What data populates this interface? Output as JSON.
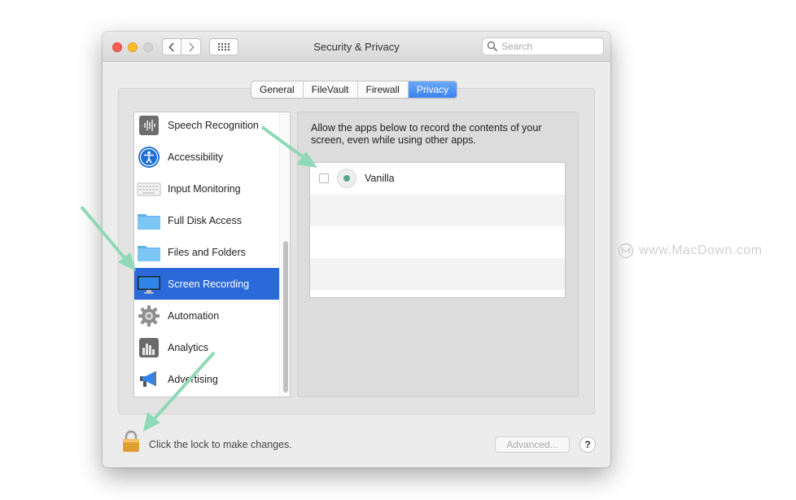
{
  "window": {
    "title": "Security & Privacy",
    "search_placeholder": "Search"
  },
  "tabs": [
    {
      "label": "General",
      "active": false
    },
    {
      "label": "FileVault",
      "active": false
    },
    {
      "label": "Firewall",
      "active": false
    },
    {
      "label": "Privacy",
      "active": true
    }
  ],
  "sidebar": {
    "items": [
      {
        "label": "Speech Recognition",
        "icon": "waveform-icon"
      },
      {
        "label": "Accessibility",
        "icon": "accessibility-icon"
      },
      {
        "label": "Input Monitoring",
        "icon": "keyboard-icon"
      },
      {
        "label": "Full Disk Access",
        "icon": "folder-icon"
      },
      {
        "label": "Files and Folders",
        "icon": "folder-icon"
      },
      {
        "label": "Screen Recording",
        "icon": "display-icon",
        "selected": true
      },
      {
        "label": "Automation",
        "icon": "gear-icon"
      },
      {
        "label": "Analytics",
        "icon": "bar-chart-icon"
      },
      {
        "label": "Advertising",
        "icon": "megaphone-icon"
      }
    ]
  },
  "detail": {
    "description": "Allow the apps below to record the contents of your screen, even while using other apps.",
    "apps": [
      {
        "name": "Vanilla",
        "checked": false
      }
    ]
  },
  "footer": {
    "lock_text": "Click the lock to make changes.",
    "advanced_label": "Advanced...",
    "help_label": "?"
  },
  "watermark": {
    "text": "www.MacDown.com"
  },
  "colors": {
    "accent": "#2a6ad8",
    "arrow": "#8fd9b6"
  }
}
